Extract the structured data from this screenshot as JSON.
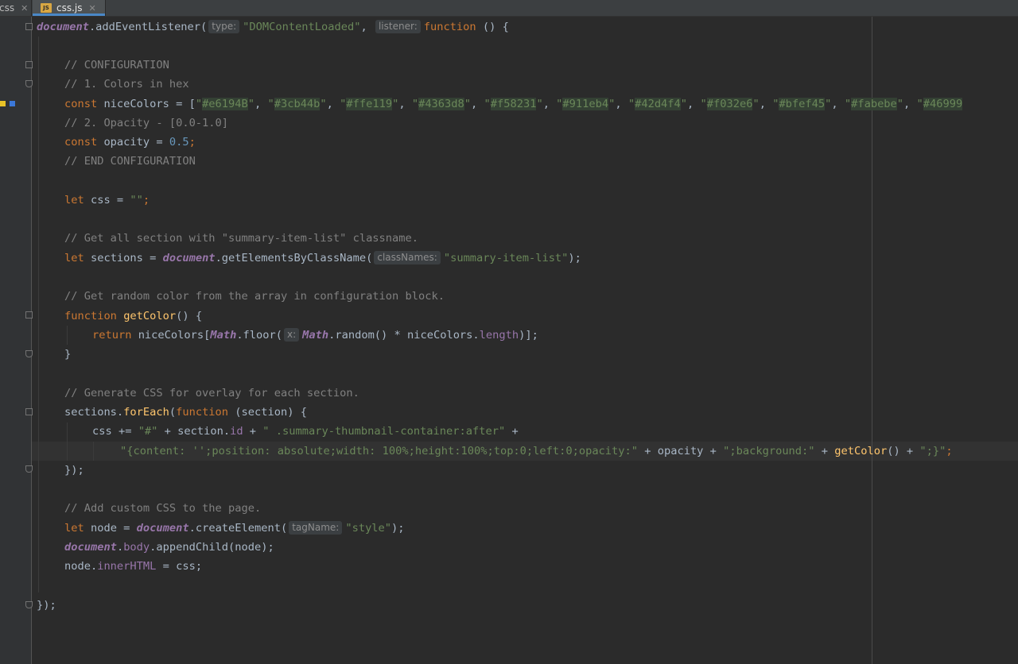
{
  "tabs": [
    {
      "label": "css"
    },
    {
      "label": "css.js",
      "icon_text": "JS"
    }
  ],
  "code": {
    "l1": {
      "doc": "document",
      "call": ".addEventListener(",
      "hint1": "type:",
      "str1": "\"DOMContentLoaded\"",
      "comma": ", ",
      "hint2": "listener:",
      "kw": "function",
      "tail": " () {"
    },
    "l3": "// CONFIGURATION",
    "l4": "// 1. Colors in hex",
    "l5": {
      "kw": "const",
      "mid": " niceColors = [",
      "comma": ", ",
      "end": "",
      "colors": [
        "#e6194B",
        "#3cb44b",
        "#ffe119",
        "#4363d8",
        "#f58231",
        "#911eb4",
        "#42d4f4",
        "#f032e6",
        "#bfef45",
        "#fabebe",
        "#46999"
      ]
    },
    "l6": "// 2. Opacity - [0.0-1.0]",
    "l7": {
      "kw": "const",
      "mid": " opacity = ",
      "num": "0.5",
      "semi": ";"
    },
    "l8": "// END CONFIGURATION",
    "l10": {
      "kw": "let",
      "mid": " css = ",
      "str": "\"\"",
      "semi": ";"
    },
    "l12": "// Get all section with \"summary-item-list\" classname.",
    "l13": {
      "kw": "let",
      "mid": " sections = ",
      "doc": "document",
      "call": ".getElementsByClassName(",
      "hint": "classNames:",
      "str": "\"summary-item-list\"",
      "tail": ");"
    },
    "l15": "// Get random color from the array in configuration block.",
    "l16": {
      "kw": "function",
      "sp": " ",
      "fn": "getColor",
      "tail": "() {"
    },
    "l17": {
      "kw": "return",
      "a": " niceColors[",
      "m1": "Math",
      "b": ".floor(",
      "hint": "x:",
      "m2": "Math",
      "c": ".random() * niceColors.",
      "prop": "length",
      "d": ")];"
    },
    "l18": "}",
    "l20": "// Generate CSS for overlay for each section.",
    "l21": {
      "a": "sections.",
      "fn": "forEach",
      "b": "(",
      "kw": "function",
      "c": " (section) {"
    },
    "l22": {
      "a": "css += ",
      "s1": "\"#\"",
      "b": " + section.",
      "prop": "id",
      "c": " + ",
      "s2": "\" .summary-thumbnail-container:after\"",
      "d": " +"
    },
    "l23": {
      "s1": "\"{content: '';position: absolute;width: 100%;height:100%;top:0;left:0;opacity:\"",
      "a": " + opacity + ",
      "s2": "\";background:\"",
      "b": " + ",
      "fn": "getColor",
      "c": "() + ",
      "s3": "\";}\"",
      "d": ";"
    },
    "l24": "});",
    "l26": "// Add custom CSS to the page.",
    "l27": {
      "kw": "let",
      "a": " node = ",
      "doc": "document",
      "b": ".createElement(",
      "hint": "tagName:",
      "str": "\"style\"",
      "c": ");"
    },
    "l28": {
      "doc": "document",
      "b": ".",
      "prop": "body",
      "c": ".appendChild(node);"
    },
    "l29": {
      "a": "node.",
      "prop": "innerHTML",
      "b": " = css;"
    },
    "l31": "});"
  }
}
